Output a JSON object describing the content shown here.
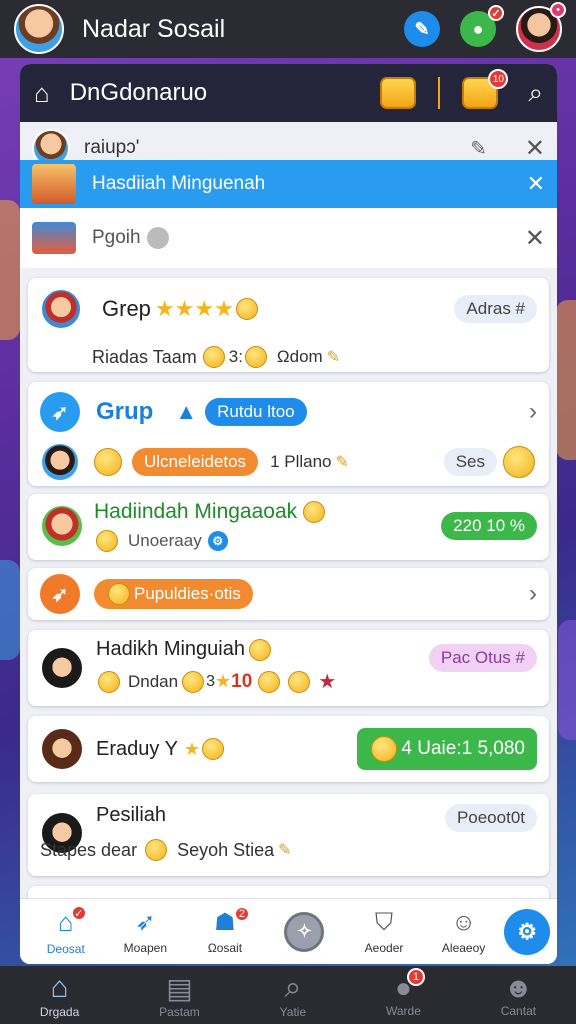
{
  "topbar": {
    "title": "Nadar Sosail"
  },
  "appbar": {
    "title": "DnGdonaruo",
    "badge_count": "10"
  },
  "rows": {
    "r1": {
      "title": "raiupɔ'"
    },
    "r2": {
      "title": "Hasdiiah Minguenah"
    },
    "r3": {
      "title": "Pgoih"
    },
    "r4": {
      "title": "Grep",
      "subtitle": "Riadas Taam",
      "sub2": "3:",
      "sub3": "Ωdom",
      "tag": "Adras #"
    },
    "r5": {
      "title": "Grup",
      "pill": "Rutdu ltoo",
      "action_pill": "Ulcneleidetos",
      "count": "1 Pllano",
      "right": "Ses"
    },
    "r6": {
      "title": "Hadiindah Mingaaoak",
      "subtitle": "Unoeraay",
      "pill": "220 10 %"
    },
    "r7": {
      "pill": "Pupuldies·otis"
    },
    "r8": {
      "title": "Hadikh Minguiah",
      "subtitle": "Dndan",
      "sub2": "3",
      "sub3": "10",
      "tag": "Pac Otus #"
    },
    "r9": {
      "title": "Eraduy Y",
      "pill": "4 Uaie:1 5,080"
    },
    "r10": {
      "title": "Pesiliah",
      "subtitle": "Stapes dear",
      "sub2": "Seyoh Stiea",
      "tag": "Poeoot0t"
    }
  },
  "bottom_nav": [
    "Deosat",
    "Moapen",
    "Ωosait",
    "",
    "Aeoder",
    "Aleaeoy"
  ],
  "bottom_badges": [
    "",
    "2"
  ],
  "sys_nav": [
    "Drgada",
    "Pastam",
    "Yatie",
    "Warde",
    "Cantat"
  ],
  "sys_badge": "1",
  "colors": {
    "accent_blue": "#1e90e8",
    "green": "#3cb84a",
    "orange": "#f28b30",
    "purple_tag": "#f1d2f5"
  }
}
